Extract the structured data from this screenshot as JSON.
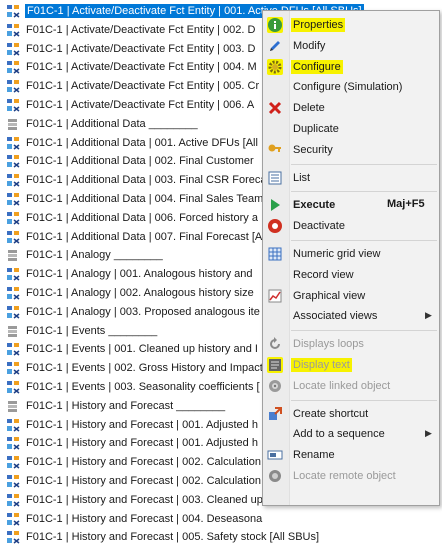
{
  "tree": {
    "selected_index": 0,
    "rows": [
      {
        "label": "F01C-1 | Activate/Deactivate Fct Entity | 001. Active DFUs [All SBUs]",
        "icon": "scenario-icon"
      },
      {
        "label": "F01C-1 | Activate/Deactivate Fct Entity | 002. D",
        "icon": "scenario-icon"
      },
      {
        "label": "F01C-1 | Activate/Deactivate Fct Entity | 003. D",
        "icon": "scenario-icon"
      },
      {
        "label": "F01C-1 | Activate/Deactivate Fct Entity | 004. M",
        "icon": "scenario-icon"
      },
      {
        "label": "F01C-1 | Activate/Deactivate Fct Entity | 005. Cr",
        "icon": "scenario-icon"
      },
      {
        "label": "F01C-1 | Activate/Deactivate Fct Entity | 006. A",
        "icon": "scenario-icon"
      },
      {
        "label": "F01C-1 | Additional Data ________",
        "icon": "folder-group-icon"
      },
      {
        "label": "F01C-1 | Additional Data | 001. Active DFUs [All",
        "icon": "scenario-icon"
      },
      {
        "label": "F01C-1 | Additional Data | 002. Final Customer",
        "icon": "scenario-icon"
      },
      {
        "label": "F01C-1 | Additional Data | 003. Final CSR Foreca",
        "icon": "scenario-icon"
      },
      {
        "label": "F01C-1 | Additional Data | 004. Final Sales Team",
        "icon": "scenario-icon"
      },
      {
        "label": "F01C-1 | Additional Data | 006. Forced history a",
        "icon": "scenario-icon"
      },
      {
        "label": "F01C-1 | Additional Data | 007. Final Forecast [A",
        "icon": "scenario-icon"
      },
      {
        "label": "F01C-1 | Analogy ________",
        "icon": "folder-group-icon"
      },
      {
        "label": "F01C-1 | Analogy | 001. Analogous history and",
        "icon": "scenario-icon"
      },
      {
        "label": "F01C-1 | Analogy | 002. Analogous history size",
        "icon": "scenario-icon"
      },
      {
        "label": "F01C-1 | Analogy | 003. Proposed analogous ite",
        "icon": "scenario-icon"
      },
      {
        "label": "F01C-1 | Events ________",
        "icon": "folder-group-icon"
      },
      {
        "label": "F01C-1 | Events | 001. Cleaned up history and I",
        "icon": "scenario-icon"
      },
      {
        "label": "F01C-1 | Events | 002. Gross History and Impact",
        "icon": "scenario-icon"
      },
      {
        "label": "F01C-1 | Events | 003. Seasonality coefficients [",
        "icon": "scenario-icon"
      },
      {
        "label": "F01C-1 | History and Forecast ________",
        "icon": "folder-group-icon"
      },
      {
        "label": "F01C-1 | History and Forecast | 001. Adjusted h",
        "icon": "scenario-icon"
      },
      {
        "label": "F01C-1 | History and Forecast | 001. Adjusted h",
        "icon": "scenario-icon"
      },
      {
        "label": "F01C-1 | History and Forecast | 002. Calculation",
        "icon": "scenario-icon"
      },
      {
        "label": "F01C-1 | History and Forecast | 002. Calculation",
        "icon": "scenario-icon"
      },
      {
        "label": "F01C-1 | History and Forecast | 003. Cleaned up",
        "icon": "scenario-icon"
      },
      {
        "label": "F01C-1 | History and Forecast | 004. Deseasona",
        "icon": "scenario-icon"
      },
      {
        "label": "F01C-1 | History and Forecast | 005. Safety stock [All SBUs]",
        "icon": "scenario-icon"
      }
    ]
  },
  "menu": {
    "items": [
      {
        "type": "item",
        "label": "Properties",
        "icon": "info-icon",
        "highlight": true,
        "disabled": false
      },
      {
        "type": "item",
        "label": "Modify",
        "icon": "pencil-icon",
        "disabled": false
      },
      {
        "type": "item",
        "label": "Configure",
        "icon": "gear-icon",
        "highlight": true,
        "disabled": false
      },
      {
        "type": "item",
        "label": "Configure (Simulation)",
        "icon": "",
        "disabled": false
      },
      {
        "type": "item",
        "label": "Delete",
        "icon": "delete-x-icon",
        "disabled": false
      },
      {
        "type": "item",
        "label": "Duplicate",
        "icon": "",
        "disabled": false
      },
      {
        "type": "item",
        "label": "Security",
        "icon": "key-icon",
        "disabled": false
      },
      {
        "type": "sep"
      },
      {
        "type": "item",
        "label": "List",
        "icon": "list-icon",
        "disabled": false
      },
      {
        "type": "sep"
      },
      {
        "type": "item",
        "label": "Execute",
        "icon": "play-icon",
        "bold": true,
        "shortcut": "Maj+F5",
        "disabled": false
      },
      {
        "type": "item",
        "label": "Deactivate",
        "icon": "stop-icon",
        "disabled": false
      },
      {
        "type": "sep"
      },
      {
        "type": "item",
        "label": "Numeric grid view",
        "icon": "grid-icon",
        "disabled": false
      },
      {
        "type": "item",
        "label": "Record view",
        "icon": "",
        "disabled": false
      },
      {
        "type": "item",
        "label": "Graphical view",
        "icon": "chart-icon",
        "disabled": false
      },
      {
        "type": "item",
        "label": "Associated views",
        "icon": "",
        "submenu": true,
        "disabled": false
      },
      {
        "type": "sep"
      },
      {
        "type": "item",
        "label": "Displays loops",
        "icon": "loop-icon",
        "disabled": true
      },
      {
        "type": "item",
        "label": "Display text",
        "icon": "text-view-icon",
        "highlight": true,
        "disabled": true
      },
      {
        "type": "item",
        "label": "Locate linked object",
        "icon": "target-icon",
        "disabled": true
      },
      {
        "type": "sep"
      },
      {
        "type": "item",
        "label": "Create shortcut",
        "icon": "shortcut-icon",
        "disabled": false
      },
      {
        "type": "item",
        "label": "Add to a sequence",
        "icon": "",
        "submenu": true,
        "disabled": false
      },
      {
        "type": "item",
        "label": "Rename",
        "icon": "rename-icon",
        "disabled": false
      },
      {
        "type": "item",
        "label": "Locate remote object",
        "icon": "remote-target-icon",
        "disabled": true
      }
    ]
  },
  "colors": {
    "selection": "#0078d7",
    "highlight": "#f7f200",
    "menu_bg": "#f2f2f2",
    "disabled_text": "#9a9a9a"
  }
}
